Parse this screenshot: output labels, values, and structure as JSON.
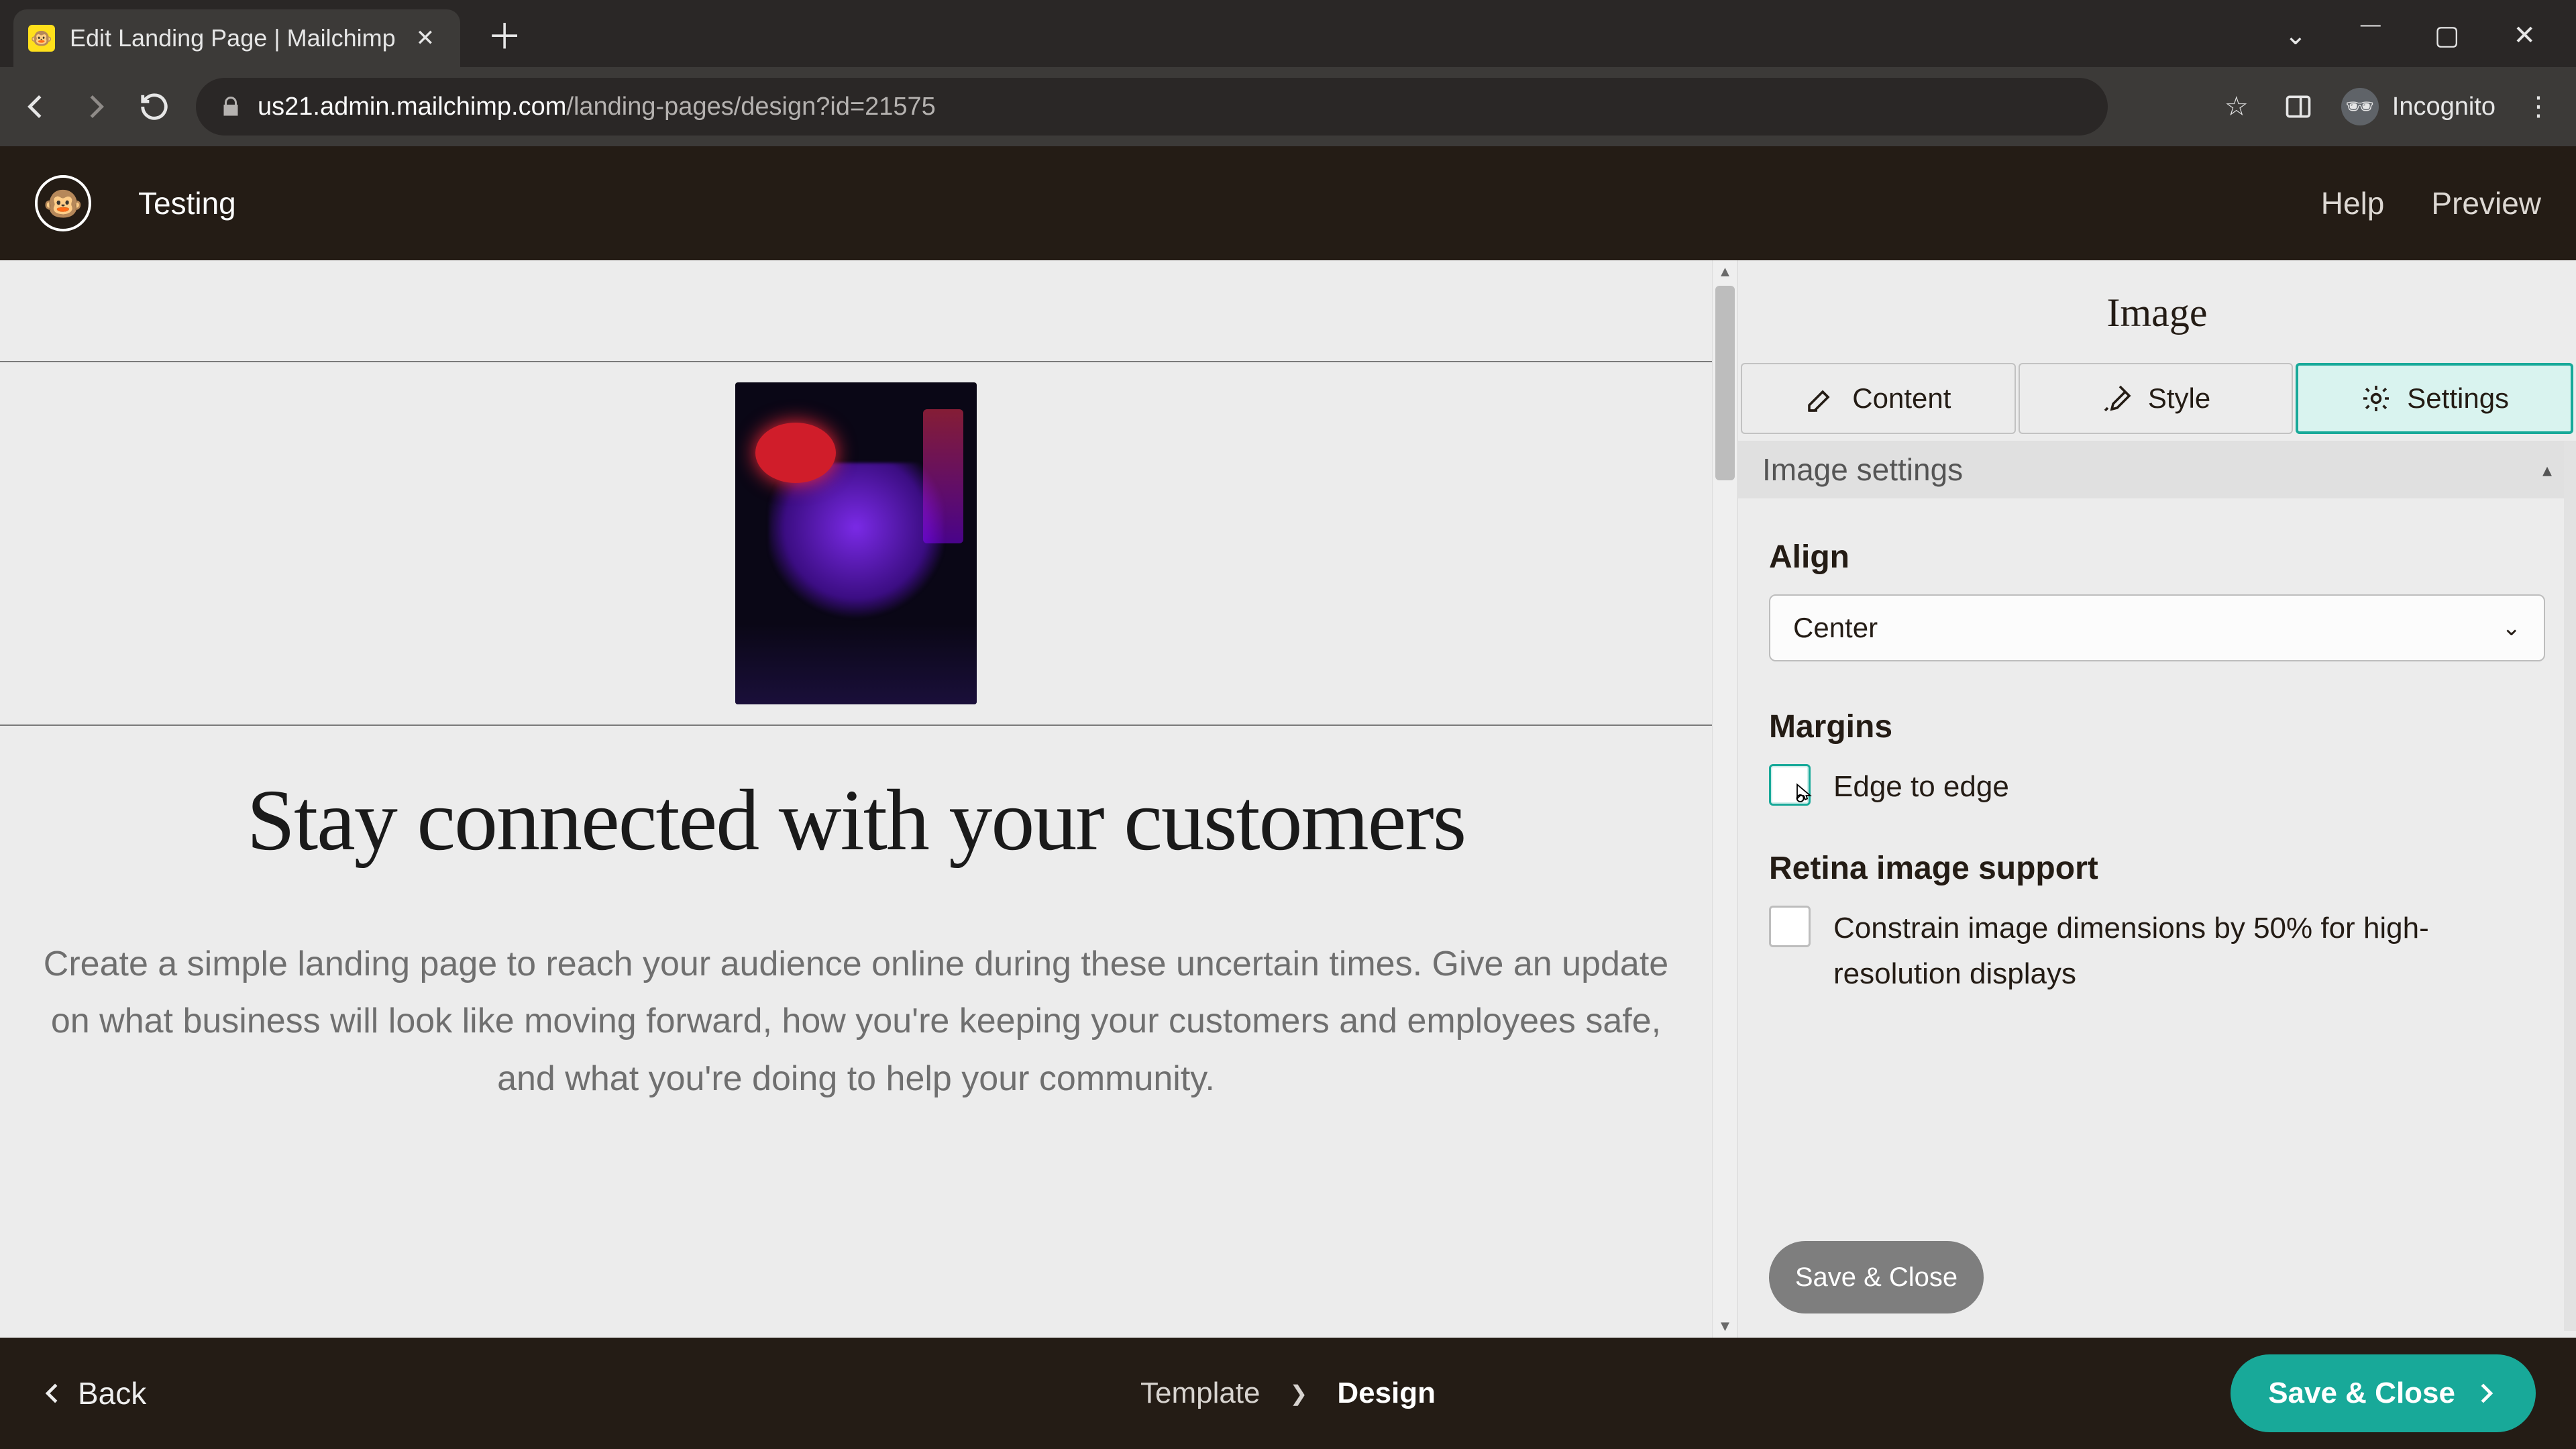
{
  "browser": {
    "tab_title": "Edit Landing Page | Mailchimp",
    "url_host": "us21.admin.mailchimp.com",
    "url_path": "/landing-pages/design?id=21575",
    "incognito_label": "Incognito"
  },
  "header": {
    "page_name": "Testing",
    "help": "Help",
    "preview": "Preview"
  },
  "canvas": {
    "headline": "Stay connected with your customers",
    "subtext": "Create a simple landing page to reach your audience online during these uncertain times. Give an update on what business will look like moving forward, how you're keeping your customers and employees safe, and what you're doing to help your community."
  },
  "panel": {
    "title": "Image",
    "tabs": {
      "content": "Content",
      "style": "Style",
      "settings": "Settings",
      "active": "settings"
    },
    "section_title": "Image settings",
    "align": {
      "label": "Align",
      "value": "Center"
    },
    "margins": {
      "label": "Margins",
      "checkbox_label": "Edge to edge"
    },
    "retina": {
      "label": "Retina image support",
      "checkbox_label": "Constrain image dimensions by 50% for high-resolution displays"
    },
    "save_inner": "Save & Close"
  },
  "footer": {
    "back": "Back",
    "step_template": "Template",
    "step_design": "Design",
    "save_close": "Save & Close"
  }
}
